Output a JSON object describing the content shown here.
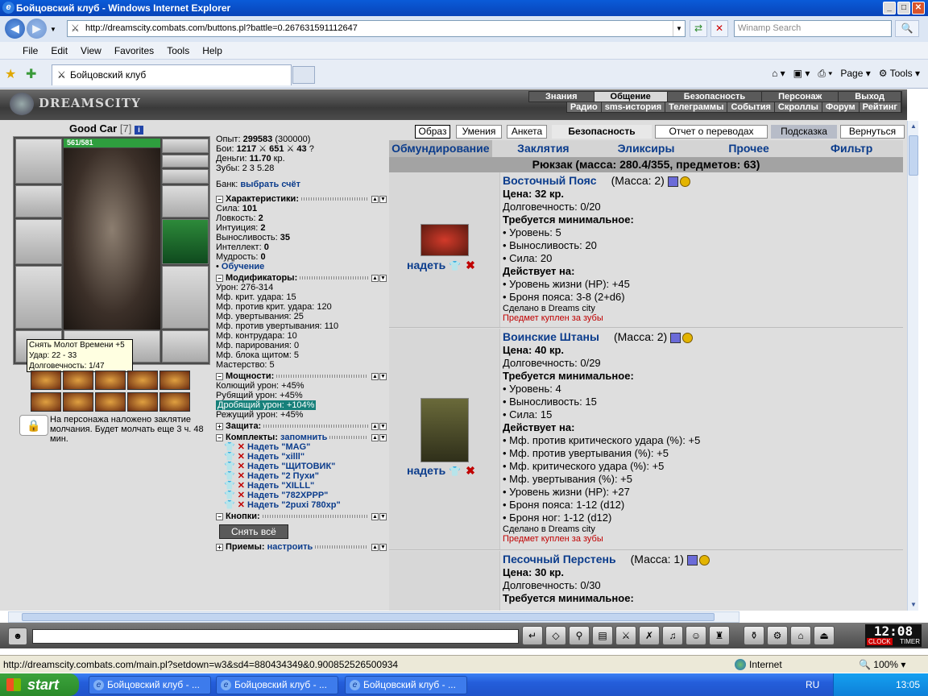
{
  "window": {
    "title": "Бойцовский клуб - Windows Internet Explorer"
  },
  "browser": {
    "url": "http://dreamscity.combats.com/buttons.pl?battle=0.267631591112647",
    "search_placeholder": "Winamp Search",
    "menu": [
      "File",
      "Edit",
      "View",
      "Favorites",
      "Tools",
      "Help"
    ],
    "tab_title": "Бойцовский клуб",
    "cmd_page": "Page",
    "cmd_tools": "Tools"
  },
  "game": {
    "logo": "DREAMSCITY",
    "top_menu": [
      "Знания",
      "Общение",
      "Безопасность",
      "Персонаж",
      "Выход"
    ],
    "top_menu_selected": "Общение",
    "sub_menu": [
      "Радио",
      "sms-история",
      "Телеграммы",
      "События",
      "Скроллы",
      "Форум",
      "Рейтинг"
    ]
  },
  "character": {
    "name": "Good Car",
    "level": "[7]",
    "hp": "561/581",
    "tooltip": [
      "Снять Молот Времени +5",
      "Удар: 22 - 33",
      "Долговечность: 1/47"
    ],
    "silence": "На персонажа наложено заклятие молчания. Будет молчать еще 3 ч. 48 мин."
  },
  "stats": {
    "exp_label": "Опыт:",
    "exp": "299583",
    "exp_next": "(300000)",
    "fights_label": "Бои:",
    "wins": "1217",
    "losses": "651",
    "draws": "43",
    "money_label": "Деньги:",
    "money": "11.70",
    "money_unit": "кр.",
    "teeth_label": "Зубы:",
    "teeth": "2 3 5.28",
    "bank_label": "Банк:",
    "bank_link": "выбрать счёт",
    "chars_title": "Характеристики:",
    "chars": [
      [
        "Сила:",
        "101"
      ],
      [
        "Ловкость:",
        "2"
      ],
      [
        "Интуиция:",
        "2"
      ],
      [
        "Выносливость:",
        "35"
      ],
      [
        "Интеллект:",
        "0"
      ],
      [
        "Мудрость:",
        "0"
      ]
    ],
    "training": "Обучение",
    "mods_title": "Модификаторы:",
    "mods": [
      "Урон: 276-314",
      "Мф. крит. удара: 15",
      "Мф. против крит. удара: 120",
      "Мф. увертывания: 25",
      "Мф. против увертывания: 110",
      "Мф. контрудара: 10",
      "Мф. парирования: 0",
      "Мф. блока щитом: 5",
      "Мастерство: 5"
    ],
    "power_title": "Мощности:",
    "powers": [
      "Колющий урон: +45%",
      "Рубящий урон: +45%",
      "Дробящий урон: +104%",
      "Режущий урон: +45%"
    ],
    "defense_title": "Защита:",
    "kits_title": "Комплекты:",
    "kits_remember": "запомнить",
    "kits": [
      "Надеть \"MAG\"",
      "Надеть \"xilll\"",
      "Надеть \"ЩИТОВИК\"",
      "Надеть \"2 Пухи\"",
      "Надеть \"XILLL\"",
      "Надеть \"782XPPP\"",
      "Надеть \"2puxi 780xp\""
    ],
    "buttons_title": "Кнопки:",
    "remove_all": "Снять всё",
    "techniques_title": "Приемы:",
    "techniques_link": "настроить"
  },
  "panel": {
    "buttons": [
      "Образ",
      "Умения",
      "Анкета",
      "Безопасность",
      "Отчет о переводах",
      "Подсказка",
      "Вернуться"
    ],
    "inv_tabs": [
      "Обмундирование",
      "Заклятия",
      "Эликсиры",
      "Прочее",
      "Фильтр"
    ],
    "backpack": "Рюкзак (масса: 280.4/355, предметов: 63)",
    "put_on": "надеть",
    "items": [
      {
        "name": "Восточный Пояс",
        "mass": "(Масса: 2)",
        "price": "Цена: 32 кр.",
        "durability": "Долговечность: 0/20",
        "req_title": "Требуется минимальное:",
        "reqs": [
          "• Уровень: 5",
          "• Выносливость: 20",
          "• Сила: 20"
        ],
        "eff_title": "Действует на:",
        "effects": [
          "• Уровень жизни (HP): +45",
          "• Броня пояса: 3-8 (2+d6)"
        ],
        "made": "Сделано в Dreams city",
        "bought": "Предмет куплен за зубы"
      },
      {
        "name": "Воинские Штаны",
        "mass": "(Масса: 2)",
        "price": "Цена: 40 кр.",
        "durability": "Долговечность: 0/29",
        "req_title": "Требуется минимальное:",
        "reqs": [
          "• Уровень: 4",
          "• Выносливость: 15",
          "• Сила: 15"
        ],
        "eff_title": "Действует на:",
        "effects": [
          "• Мф. против критического удара (%): +5",
          "• Мф. против увертывания (%): +5",
          "• Мф. критического удара (%): +5",
          "• Мф. увертывания (%): +5",
          "• Уровень жизни (HP): +27",
          "• Броня пояса: 1-12 (d12)",
          "• Броня ног: 1-12 (d12)"
        ],
        "made": "Сделано в Dreams city",
        "bought": "Предмет куплен за зубы"
      },
      {
        "name": "Песочный Перстень",
        "mass": "(Масса: 1)",
        "price": "Цена: 30 кр.",
        "durability": "Долговечность: 0/30",
        "req_title": "Требуется минимальное:"
      }
    ]
  },
  "bottom": {
    "clock": "12:08",
    "clock_label": "CLOCK",
    "timer_label": "TIMER"
  },
  "status": {
    "url": "http://dreamscity.combats.com/main.pl?setdown=w3&sd4=880434349&0.900852526500934",
    "zone": "Internet",
    "zoom": "100%"
  },
  "taskbar": {
    "start": "start",
    "tasks": [
      "Бойцовский клуб - ...",
      "Бойцовский клуб - ...",
      "Бойцовский клуб - ..."
    ],
    "lang": "RU",
    "time": "13:05"
  }
}
